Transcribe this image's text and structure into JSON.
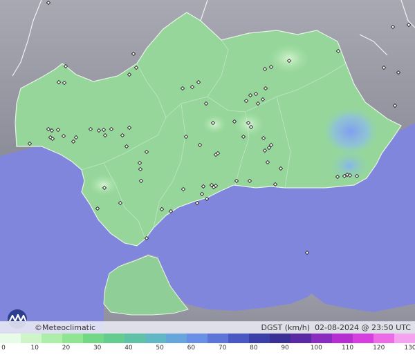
{
  "map": {
    "brand": "©Meteoclimatic",
    "variable": "DGST (km/h)",
    "timestamp": "02-08-2024 @ 23:50 UTC"
  },
  "legend": {
    "ticks": [
      "0",
      "10",
      "20",
      "30",
      "40",
      "50",
      "60",
      "70",
      "80",
      "90",
      "100",
      "110",
      "120",
      "130"
    ],
    "colors": [
      "#e8fbe6",
      "#cdf5c8",
      "#aeeeaa",
      "#8fe592",
      "#72d886",
      "#63cc8e",
      "#5fc2a6",
      "#62b7c4",
      "#66a6dc",
      "#6a8fe6",
      "#5d74d8",
      "#4a58c4",
      "#3b3fa8",
      "#3a2f95",
      "#5a2aa5",
      "#8a2cc0",
      "#b52ed2",
      "#d63ee0",
      "#ec6ce8",
      "#f5a3f0"
    ],
    "markers": [
      [
        70,
        4
      ],
      [
        568,
        39
      ],
      [
        591,
        36
      ],
      [
        193,
        78
      ],
      [
        489,
        74
      ],
      [
        418,
        88
      ],
      [
        95,
        96
      ],
      [
        197,
        98
      ],
      [
        392,
        97
      ],
      [
        383,
        100
      ],
      [
        187,
        108
      ],
      [
        85,
        119
      ],
      [
        93,
        120
      ],
      [
        555,
        98
      ],
      [
        576,
        105
      ],
      [
        287,
        119
      ],
      [
        264,
        128
      ],
      [
        278,
        126
      ],
      [
        384,
        128
      ],
      [
        370,
        136
      ],
      [
        362,
        138
      ],
      [
        571,
        153
      ],
      [
        356,
        146
      ],
      [
        380,
        144
      ],
      [
        298,
        150
      ],
      [
        373,
        150
      ],
      [
        70,
        187
      ],
      [
        75,
        189
      ],
      [
        84,
        188
      ],
      [
        73,
        199
      ],
      [
        76,
        201
      ],
      [
        92,
        197
      ],
      [
        110,
        199
      ],
      [
        131,
        187
      ],
      [
        143,
        189
      ],
      [
        150,
        188
      ],
      [
        161,
        187
      ],
      [
        187,
        185
      ],
      [
        177,
        196
      ],
      [
        152,
        196
      ],
      [
        106,
        205
      ],
      [
        43,
        208
      ],
      [
        308,
        178
      ],
      [
        359,
        178
      ],
      [
        363,
        184
      ],
      [
        339,
        176
      ],
      [
        269,
        198
      ],
      [
        352,
        198
      ],
      [
        381,
        200
      ],
      [
        392,
        210
      ],
      [
        389,
        214
      ],
      [
        383,
        218
      ],
      [
        183,
        212
      ],
      [
        212,
        220
      ],
      [
        289,
        210
      ],
      [
        312,
        224
      ],
      [
        315,
        222
      ],
      [
        202,
        236
      ],
      [
        387,
        235
      ],
      [
        406,
        244
      ],
      [
        203,
        245
      ],
      [
        204,
        262
      ],
      [
        342,
        262
      ],
      [
        361,
        262
      ],
      [
        398,
        267
      ],
      [
        488,
        256
      ],
      [
        498,
        255
      ],
      [
        502,
        253
      ],
      [
        506,
        254
      ],
      [
        516,
        255
      ],
      [
        151,
        272
      ],
      [
        265,
        274
      ],
      [
        294,
        270
      ],
      [
        306,
        268
      ],
      [
        309,
        271
      ],
      [
        312,
        269
      ],
      [
        292,
        281
      ],
      [
        299,
        288
      ],
      [
        174,
        294
      ],
      [
        141,
        302
      ],
      [
        285,
        294
      ],
      [
        234,
        303
      ],
      [
        247,
        306
      ],
      [
        212,
        345
      ],
      [
        444,
        366
      ]
    ]
  }
}
